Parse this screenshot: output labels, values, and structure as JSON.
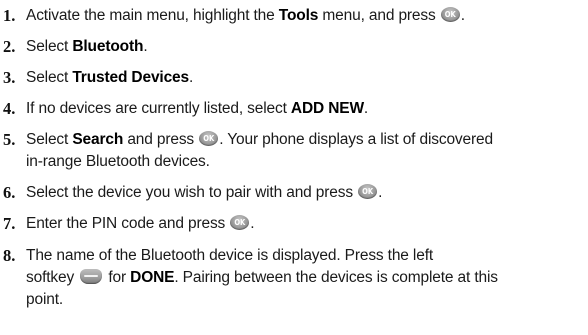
{
  "steps": [
    {
      "number": "1.",
      "parts": [
        {
          "text": "Activate the main menu, highlight the "
        },
        {
          "text": "Tools",
          "bold": true
        },
        {
          "text": " menu, and press "
        },
        {
          "icon": "ok-key-icon"
        },
        {
          "text": "."
        }
      ]
    },
    {
      "number": "2.",
      "parts": [
        {
          "text": "Select "
        },
        {
          "text": "Bluetooth",
          "bold": true
        },
        {
          "text": "."
        }
      ]
    },
    {
      "number": "3.",
      "parts": [
        {
          "text": "Select "
        },
        {
          "text": "Trusted Devices",
          "bold": true
        },
        {
          "text": "."
        }
      ]
    },
    {
      "number": "4.",
      "parts": [
        {
          "text": "If no devices are currently listed, select "
        },
        {
          "text": "ADD NEW",
          "bold": true
        },
        {
          "text": "."
        }
      ]
    },
    {
      "number": "5.",
      "parts": [
        {
          "text": "Select "
        },
        {
          "text": "Search",
          "bold": true
        },
        {
          "text": " and press "
        },
        {
          "icon": "ok-key-icon"
        },
        {
          "text": ". Your phone displays a list of discovered"
        },
        {
          "break": true
        },
        {
          "text": "in-range Bluetooth devices."
        }
      ]
    },
    {
      "number": "6.",
      "parts": [
        {
          "text": "Select the device you wish to pair with and press "
        },
        {
          "icon": "ok-key-icon"
        },
        {
          "text": "."
        }
      ]
    },
    {
      "number": "7.",
      "parts": [
        {
          "text": "Enter the PIN code and press "
        },
        {
          "icon": "ok-key-icon"
        },
        {
          "text": "."
        }
      ]
    },
    {
      "number": "8.",
      "parts": [
        {
          "text": "The name of the Bluetooth device is displayed. Press the left"
        },
        {
          "break": true
        },
        {
          "text": "softkey "
        },
        {
          "icon": "left-softkey-icon"
        },
        {
          "text": " for "
        },
        {
          "text": "DONE",
          "bold": true
        },
        {
          "text": ". Pairing between the devices is complete at this"
        },
        {
          "break": true
        },
        {
          "text": "point."
        }
      ]
    }
  ]
}
